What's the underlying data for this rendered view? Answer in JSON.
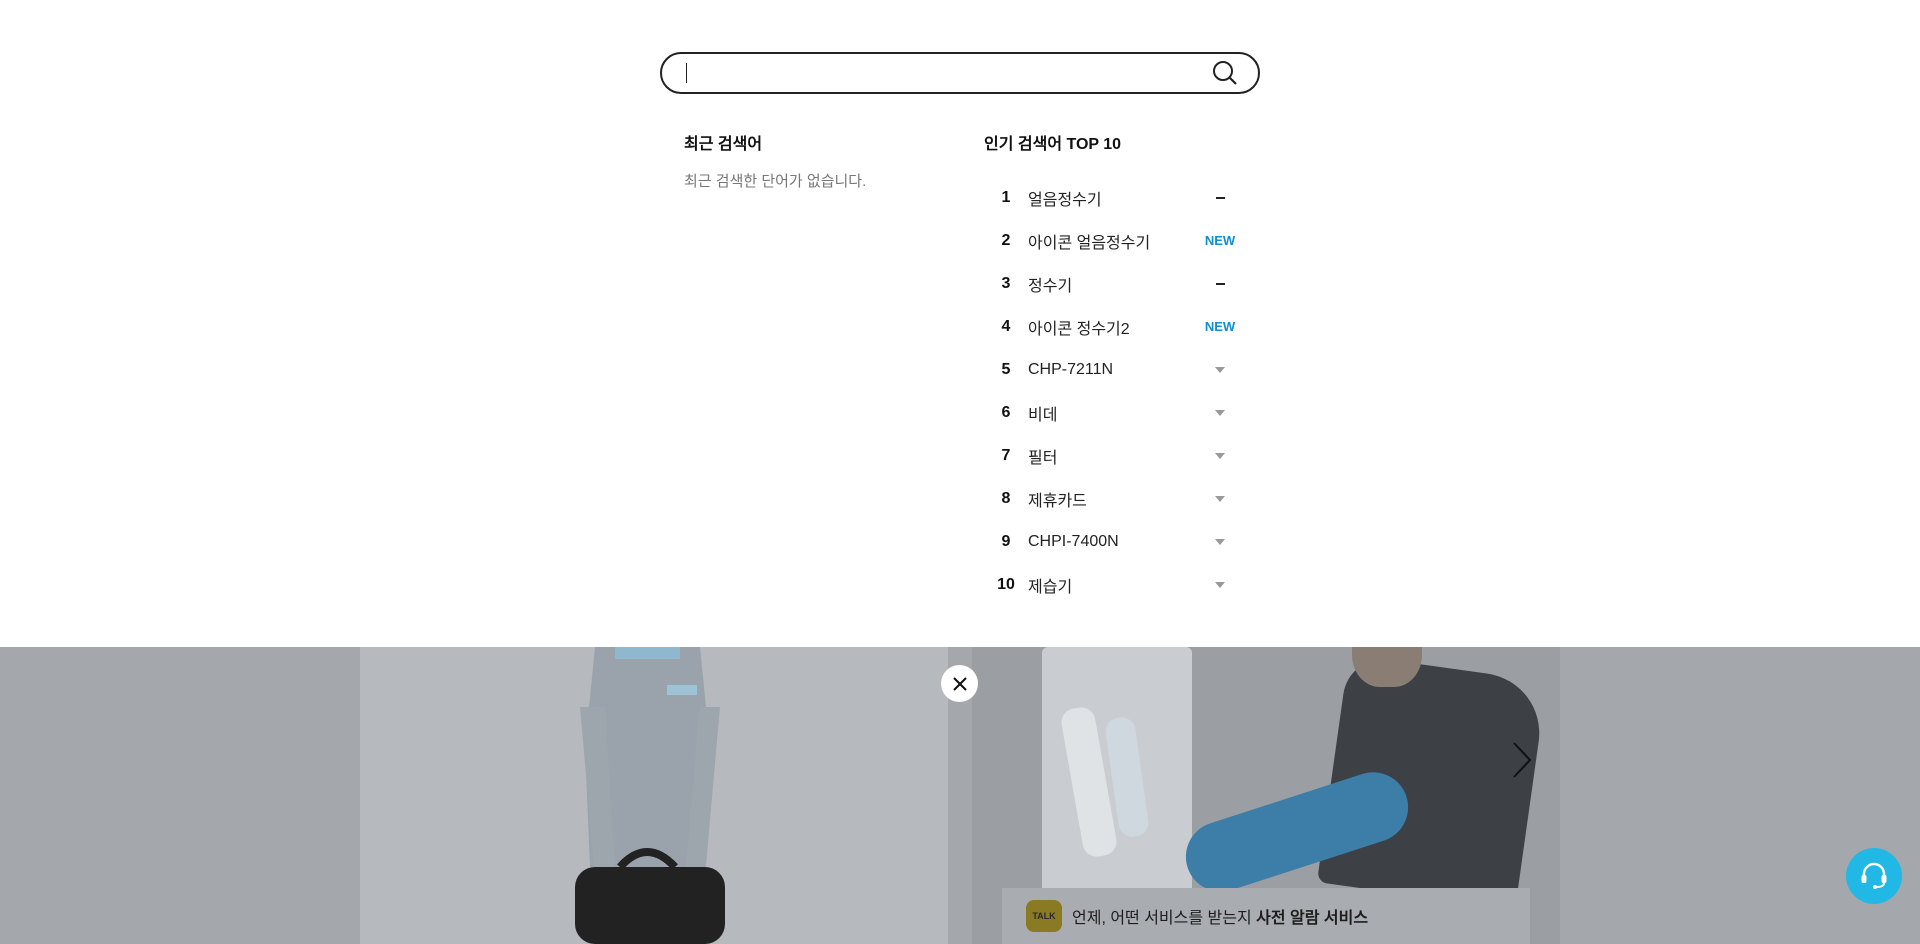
{
  "search": {
    "value": "",
    "placeholder": ""
  },
  "recent": {
    "title": "최근 검색어",
    "empty_text": "최근 검색한 단어가 없습니다."
  },
  "popular": {
    "title": "인기 검색어 TOP 10",
    "items": [
      {
        "rank": "1",
        "word": "얼음정수기",
        "status": "same"
      },
      {
        "rank": "2",
        "word": "아이콘 얼음정수기",
        "status": "new",
        "status_label": "NEW"
      },
      {
        "rank": "3",
        "word": "정수기",
        "status": "same"
      },
      {
        "rank": "4",
        "word": "아이콘 정수기2",
        "status": "new",
        "status_label": "NEW"
      },
      {
        "rank": "5",
        "word": "CHP-7211N",
        "status": "down"
      },
      {
        "rank": "6",
        "word": "비데",
        "status": "down"
      },
      {
        "rank": "7",
        "word": "필터",
        "status": "down"
      },
      {
        "rank": "8",
        "word": "제휴카드",
        "status": "down"
      },
      {
        "rank": "9",
        "word": "CHPI-7400N",
        "status": "down"
      },
      {
        "rank": "10",
        "word": "제습기",
        "status": "down"
      }
    ]
  },
  "banner": {
    "talk_icon_label": "TALK",
    "text_prefix": "언제, 어떤 서비스를 받는지 ",
    "text_bold": "사전 알람 서비스"
  },
  "colors": {
    "accent_new": "#0d8fd0",
    "chat_fab": "#22b8e6"
  },
  "icons": {
    "search": "search-icon",
    "close": "close-icon",
    "next": "chevron-right-icon",
    "chat": "headset-icon"
  }
}
